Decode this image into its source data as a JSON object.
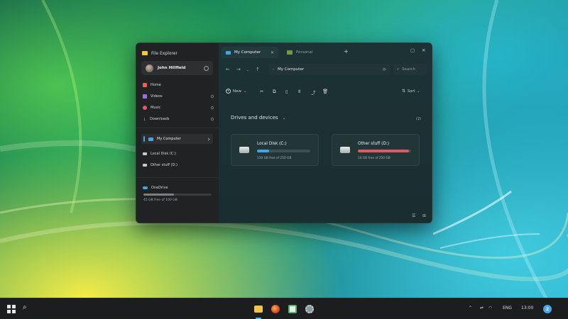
{
  "app": {
    "title": "File Explorer"
  },
  "user": {
    "name": "John Hillfield"
  },
  "sidebar": {
    "pinned": [
      {
        "label": "Home",
        "icon": "home-icon",
        "color": "#e9624a"
      },
      {
        "label": "Videos",
        "icon": "videos-icon",
        "color": "#9b6ee0"
      },
      {
        "label": "Music",
        "icon": "music-icon",
        "color": "#e05a6a"
      },
      {
        "label": "Downloads",
        "icon": "download-icon",
        "color": "#3ab08a"
      }
    ],
    "this_pc": "My Computer",
    "drives": [
      {
        "label": "Local Disk (C:)",
        "icon": "drive-icon"
      },
      {
        "label": "Other stuff (D:)",
        "icon": "drive-icon"
      }
    ],
    "onedrive": {
      "label": "OneDrive",
      "usage_text": "45 GB free of 100 GB",
      "used_fraction": 0.45
    }
  },
  "tabs": [
    {
      "label": "My Computer",
      "active": true,
      "icon": "computer-icon"
    },
    {
      "label": "Personal",
      "active": false,
      "icon": "folder-icon"
    }
  ],
  "address": {
    "path": "My Computer"
  },
  "search": {
    "placeholder": "Search"
  },
  "toolbar": {
    "new_label": "New",
    "sort_label": "Sort"
  },
  "content": {
    "section_title": "Drives and devices",
    "count": "(2)",
    "drives": [
      {
        "name": "Local Disk (C:)",
        "free_text": "130 GB free of 250 GB",
        "used_fraction": 0.22,
        "bar_color": "#3fa7e8"
      },
      {
        "name": "Other stuff (D:)",
        "free_text": "10 GB free of 250 GB",
        "used_fraction": 0.96,
        "bar_color": "#e05a64"
      }
    ]
  },
  "taskbar": {
    "language": "ENG",
    "time": "13:00",
    "notification_count": "2"
  },
  "colors": {
    "accent": "#3fa7e8",
    "warning_bar": "#e05a64",
    "folder": "#f3c44a"
  }
}
